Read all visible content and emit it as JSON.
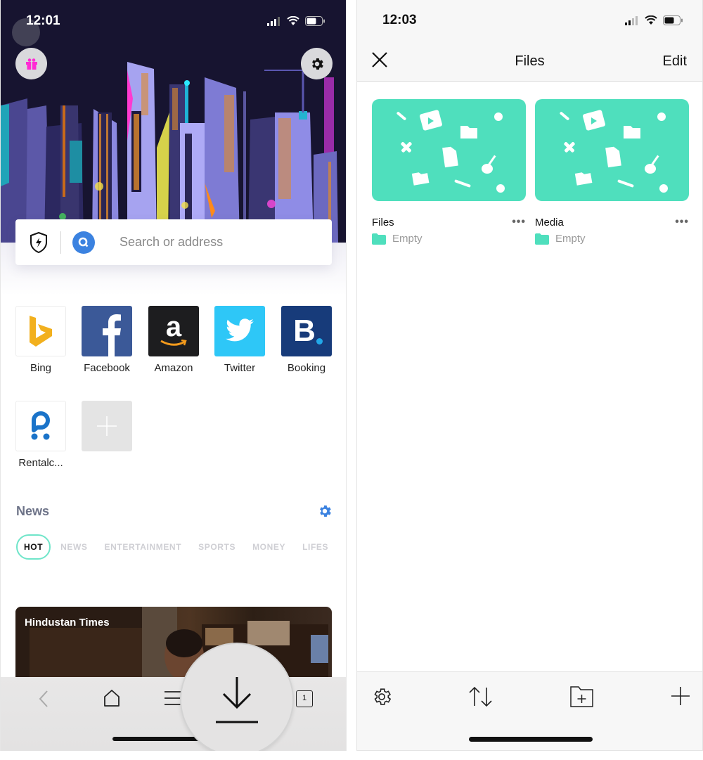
{
  "left_screen": {
    "status_bar": {
      "time": "12:01"
    },
    "header_buttons": {
      "gift_icon": "gift-icon",
      "settings_icon": "gear-icon"
    },
    "search": {
      "placeholder": "Search or address",
      "shield_icon": "shield-lightning-icon",
      "search_icon": "search-icon"
    },
    "speed_dial": [
      {
        "label": "Bing",
        "icon": "bing-logo",
        "bg": "#ffffff"
      },
      {
        "label": "Facebook",
        "icon": "facebook-logo",
        "bg": "#3b5998"
      },
      {
        "label": "Amazon",
        "icon": "amazon-logo",
        "bg": "#1d1d1f"
      },
      {
        "label": "Twitter",
        "icon": "twitter-logo",
        "bg": "#2ec7f7"
      },
      {
        "label": "Booking",
        "icon": "booking-logo",
        "bg": "#173b7a"
      },
      {
        "label": "Rentalc...",
        "icon": "rentalcars-logo",
        "bg": "#ffffff"
      },
      {
        "label": "",
        "icon": "add-shortcut-plus",
        "bg": "#e4e4e4"
      }
    ],
    "news": {
      "title": "News",
      "categories": [
        "HOT",
        "NEWS",
        "ENTERTAINMENT",
        "SPORTS",
        "MONEY",
        "LIFES"
      ],
      "active_category": "HOT",
      "card": {
        "source": "Hindustan Times"
      }
    },
    "bottom_bar": {
      "items": [
        "back",
        "home",
        "menu",
        "download",
        "tabs"
      ],
      "tab_count": "1"
    },
    "colors": {
      "accent": "#3b82e0",
      "active_tab_border": "#6fe5c9",
      "gift": "#ff2ad4"
    }
  },
  "right_screen": {
    "status_bar": {
      "time": "12:03"
    },
    "nav": {
      "title": "Files",
      "edit_label": "Edit"
    },
    "folders": [
      {
        "name": "Files",
        "status": "Empty"
      },
      {
        "name": "Media",
        "status": "Empty"
      }
    ],
    "more_label": "•••",
    "toolbar": {
      "items": [
        "settings",
        "sort",
        "new-folder",
        "add"
      ]
    },
    "colors": {
      "folder_thumb": "#4fdfbd"
    }
  }
}
